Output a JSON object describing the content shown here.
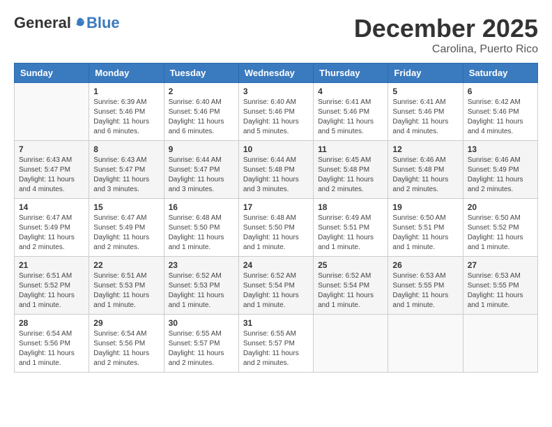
{
  "header": {
    "logo_general": "General",
    "logo_blue": "Blue",
    "title": "December 2025",
    "subtitle": "Carolina, Puerto Rico"
  },
  "calendar": {
    "days_of_week": [
      "Sunday",
      "Monday",
      "Tuesday",
      "Wednesday",
      "Thursday",
      "Friday",
      "Saturday"
    ],
    "weeks": [
      [
        {
          "day": "",
          "info": ""
        },
        {
          "day": "1",
          "info": "Sunrise: 6:39 AM\nSunset: 5:46 PM\nDaylight: 11 hours\nand 6 minutes."
        },
        {
          "day": "2",
          "info": "Sunrise: 6:40 AM\nSunset: 5:46 PM\nDaylight: 11 hours\nand 6 minutes."
        },
        {
          "day": "3",
          "info": "Sunrise: 6:40 AM\nSunset: 5:46 PM\nDaylight: 11 hours\nand 5 minutes."
        },
        {
          "day": "4",
          "info": "Sunrise: 6:41 AM\nSunset: 5:46 PM\nDaylight: 11 hours\nand 5 minutes."
        },
        {
          "day": "5",
          "info": "Sunrise: 6:41 AM\nSunset: 5:46 PM\nDaylight: 11 hours\nand 4 minutes."
        },
        {
          "day": "6",
          "info": "Sunrise: 6:42 AM\nSunset: 5:46 PM\nDaylight: 11 hours\nand 4 minutes."
        }
      ],
      [
        {
          "day": "7",
          "info": "Sunrise: 6:43 AM\nSunset: 5:47 PM\nDaylight: 11 hours\nand 4 minutes."
        },
        {
          "day": "8",
          "info": "Sunrise: 6:43 AM\nSunset: 5:47 PM\nDaylight: 11 hours\nand 3 minutes."
        },
        {
          "day": "9",
          "info": "Sunrise: 6:44 AM\nSunset: 5:47 PM\nDaylight: 11 hours\nand 3 minutes."
        },
        {
          "day": "10",
          "info": "Sunrise: 6:44 AM\nSunset: 5:48 PM\nDaylight: 11 hours\nand 3 minutes."
        },
        {
          "day": "11",
          "info": "Sunrise: 6:45 AM\nSunset: 5:48 PM\nDaylight: 11 hours\nand 2 minutes."
        },
        {
          "day": "12",
          "info": "Sunrise: 6:46 AM\nSunset: 5:48 PM\nDaylight: 11 hours\nand 2 minutes."
        },
        {
          "day": "13",
          "info": "Sunrise: 6:46 AM\nSunset: 5:49 PM\nDaylight: 11 hours\nand 2 minutes."
        }
      ],
      [
        {
          "day": "14",
          "info": "Sunrise: 6:47 AM\nSunset: 5:49 PM\nDaylight: 11 hours\nand 2 minutes."
        },
        {
          "day": "15",
          "info": "Sunrise: 6:47 AM\nSunset: 5:49 PM\nDaylight: 11 hours\nand 2 minutes."
        },
        {
          "day": "16",
          "info": "Sunrise: 6:48 AM\nSunset: 5:50 PM\nDaylight: 11 hours\nand 1 minute."
        },
        {
          "day": "17",
          "info": "Sunrise: 6:48 AM\nSunset: 5:50 PM\nDaylight: 11 hours\nand 1 minute."
        },
        {
          "day": "18",
          "info": "Sunrise: 6:49 AM\nSunset: 5:51 PM\nDaylight: 11 hours\nand 1 minute."
        },
        {
          "day": "19",
          "info": "Sunrise: 6:50 AM\nSunset: 5:51 PM\nDaylight: 11 hours\nand 1 minute."
        },
        {
          "day": "20",
          "info": "Sunrise: 6:50 AM\nSunset: 5:52 PM\nDaylight: 11 hours\nand 1 minute."
        }
      ],
      [
        {
          "day": "21",
          "info": "Sunrise: 6:51 AM\nSunset: 5:52 PM\nDaylight: 11 hours\nand 1 minute."
        },
        {
          "day": "22",
          "info": "Sunrise: 6:51 AM\nSunset: 5:53 PM\nDaylight: 11 hours\nand 1 minute."
        },
        {
          "day": "23",
          "info": "Sunrise: 6:52 AM\nSunset: 5:53 PM\nDaylight: 11 hours\nand 1 minute."
        },
        {
          "day": "24",
          "info": "Sunrise: 6:52 AM\nSunset: 5:54 PM\nDaylight: 11 hours\nand 1 minute."
        },
        {
          "day": "25",
          "info": "Sunrise: 6:52 AM\nSunset: 5:54 PM\nDaylight: 11 hours\nand 1 minute."
        },
        {
          "day": "26",
          "info": "Sunrise: 6:53 AM\nSunset: 5:55 PM\nDaylight: 11 hours\nand 1 minute."
        },
        {
          "day": "27",
          "info": "Sunrise: 6:53 AM\nSunset: 5:55 PM\nDaylight: 11 hours\nand 1 minute."
        }
      ],
      [
        {
          "day": "28",
          "info": "Sunrise: 6:54 AM\nSunset: 5:56 PM\nDaylight: 11 hours\nand 1 minute."
        },
        {
          "day": "29",
          "info": "Sunrise: 6:54 AM\nSunset: 5:56 PM\nDaylight: 11 hours\nand 2 minutes."
        },
        {
          "day": "30",
          "info": "Sunrise: 6:55 AM\nSunset: 5:57 PM\nDaylight: 11 hours\nand 2 minutes."
        },
        {
          "day": "31",
          "info": "Sunrise: 6:55 AM\nSunset: 5:57 PM\nDaylight: 11 hours\nand 2 minutes."
        },
        {
          "day": "",
          "info": ""
        },
        {
          "day": "",
          "info": ""
        },
        {
          "day": "",
          "info": ""
        }
      ]
    ]
  }
}
